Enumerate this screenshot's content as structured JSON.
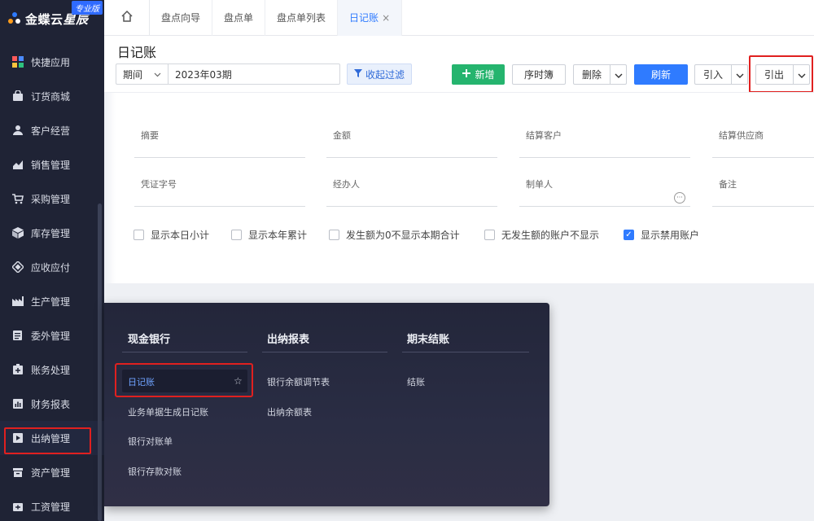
{
  "brand": {
    "name_main": "金蝶云",
    "name_italic": "星辰",
    "badge": "专业版"
  },
  "sidebar": {
    "items": [
      {
        "label": "快捷应用",
        "icon": "apps-grid-icon"
      },
      {
        "label": "订货商城",
        "icon": "shop-bag-icon"
      },
      {
        "label": "客户经营",
        "icon": "customer-icon"
      },
      {
        "label": "销售管理",
        "icon": "sales-chart-icon"
      },
      {
        "label": "采购管理",
        "icon": "cart-icon"
      },
      {
        "label": "库存管理",
        "icon": "box-icon"
      },
      {
        "label": "应收应付",
        "icon": "receivable-icon"
      },
      {
        "label": "生产管理",
        "icon": "factory-icon"
      },
      {
        "label": "委外管理",
        "icon": "outsource-icon"
      },
      {
        "label": "账务处理",
        "icon": "ledger-icon"
      },
      {
        "label": "财务报表",
        "icon": "report-icon"
      },
      {
        "label": "出纳管理",
        "icon": "cashier-icon"
      },
      {
        "label": "资产管理",
        "icon": "asset-icon"
      },
      {
        "label": "工资管理",
        "icon": "salary-icon"
      }
    ]
  },
  "tabs": [
    {
      "label": "盘点向导"
    },
    {
      "label": "盘点单"
    },
    {
      "label": "盘点单列表"
    },
    {
      "label": "日记账",
      "close": "×"
    }
  ],
  "page": {
    "title": "日记账",
    "period_label": "期间",
    "period_value": "2023年03期",
    "collapse_filter": "收起过滤"
  },
  "toolbar": {
    "add": "新增",
    "seq": "序时簿",
    "delete": "删除",
    "refresh": "刷新",
    "import": "引入",
    "export": "引出"
  },
  "filters": {
    "summary": "摘要",
    "amount": "金额",
    "settle_customer": "结算客户",
    "settle_supplier": "结算供应商",
    "voucher_no": "凭证字号",
    "handler": "经办人",
    "maker": "制单人",
    "remark": "备注"
  },
  "checks": [
    {
      "label": "显示本日小计",
      "checked": false
    },
    {
      "label": "显示本年累计",
      "checked": false
    },
    {
      "label": "发生额为0不显示本期合计",
      "checked": false
    },
    {
      "label": "无发生额的账户不显示",
      "checked": false
    },
    {
      "label": "显示禁用账户",
      "checked": true
    }
  ],
  "popup": {
    "col1": {
      "title": "现金银行",
      "items": [
        "日记账",
        "业务单据生成日记账",
        "银行对账单",
        "银行存款对账"
      ]
    },
    "col2": {
      "title": "出纳报表",
      "items": [
        "银行余额调节表",
        "出纳余额表"
      ]
    },
    "col3": {
      "title": "期末结账",
      "items": [
        "结账"
      ]
    }
  },
  "colors": {
    "accent": "#2f7bff",
    "green": "#25b46e",
    "highlight": "#e0201f",
    "sidebar": "#1f2335"
  }
}
